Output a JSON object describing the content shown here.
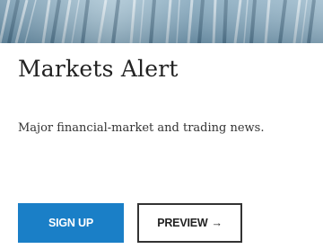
{
  "newsletter": {
    "title": "Markets Alert",
    "description": "Major financial-market and trading news."
  },
  "actions": {
    "signup_label": "SIGN UP",
    "preview_label": "PREVIEW",
    "preview_arrow": "→"
  },
  "colors": {
    "signup_background": "#1a7fc7",
    "preview_border": "#333333",
    "title_text": "#222222",
    "hero_tint": "#8fb2c6"
  },
  "icons": {
    "preview_arrow": "arrow-right-icon"
  }
}
